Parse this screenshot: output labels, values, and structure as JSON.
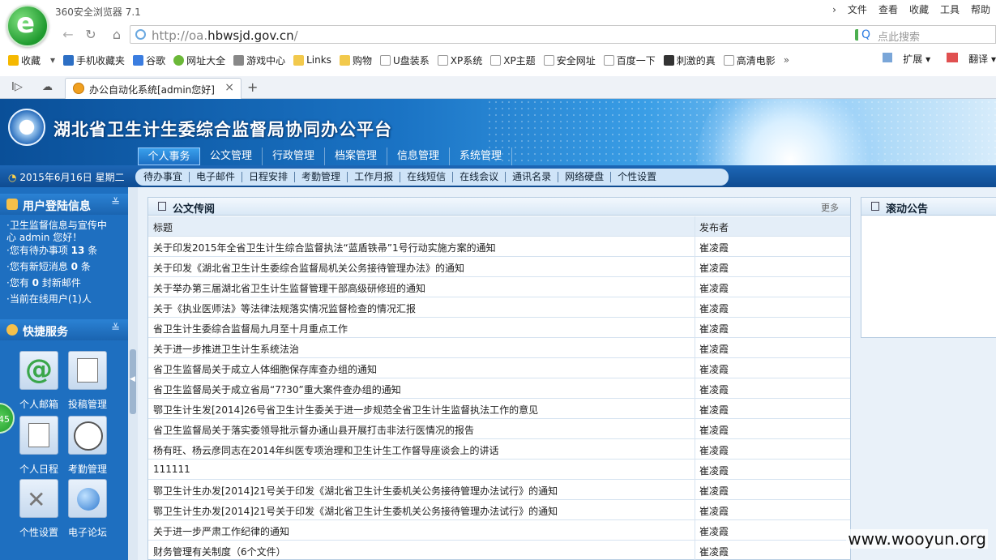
{
  "browser": {
    "app_name": "360安全浏览器 7.1",
    "menu": [
      "文件",
      "查看",
      "收藏",
      "工具",
      "帮助"
    ],
    "url_prefix": "http://oa.",
    "url_domain": "hbwsjd.gov.cn",
    "url_suffix": "/",
    "search_placeholder": "点此搜索",
    "bookmarks": [
      "收藏",
      "手机收藏夹",
      "谷歌",
      "网址大全",
      "游戏中心",
      "Links",
      "购物",
      "U盘装系",
      "XP系统",
      "XP主题",
      "安全网址",
      "百度一下",
      "刺激的真",
      "高清电影"
    ],
    "bookmarks_more": "»",
    "extensions": "扩展",
    "translate": "翻译",
    "tab_title": "办公自动化系统[admin您好]",
    "tab_close": "×",
    "new_tab": "+"
  },
  "site": {
    "title": "湖北省卫生计生委综合监督局协同办公平台",
    "main_nav": [
      "个人事务",
      "公文管理",
      "行政管理",
      "档案管理",
      "信息管理",
      "系统管理"
    ],
    "date": "2015年6月16日 星期二",
    "sub_nav": [
      "待办事宜",
      "电子邮件",
      "日程安排",
      "考勤管理",
      "工作月报",
      "在线短信",
      "在线会议",
      "通讯名录",
      "网络硬盘",
      "个性设置"
    ]
  },
  "sidebar": {
    "user_section_title": "用户登陆信息",
    "user_lines": [
      "卫生监督信息与宣传中",
      "心 admin 您好！"
    ],
    "todo_prefix": "·您有待办事项",
    "todo_count": "13",
    "todo_suffix": "条",
    "sms_prefix": "·您有新短消息",
    "sms_count": "0",
    "sms_suffix": "条",
    "mail_prefix": "·您有",
    "mail_count": "0",
    "mail_suffix": "封新邮件",
    "online_line": "·当前在线用户(1)人",
    "quick_title": "快捷服务",
    "quick_items": [
      "个人邮箱",
      "投稿管理",
      "个人日程",
      "考勤管理",
      "个性设置",
      "电子论坛"
    ],
    "badge": "45"
  },
  "documents": {
    "title": "公文传阅",
    "more": "更多",
    "col_title": "标题",
    "col_publisher": "发布者",
    "rows": [
      {
        "title": "关于印发2015年全省卫生计生综合监督执法“蓝盾铁帚”1号行动实施方案的通知",
        "publisher": "崔凌霞"
      },
      {
        "title": "关于印发《湖北省卫生计生委综合监督局机关公务接待管理办法》的通知",
        "publisher": "崔凌霞"
      },
      {
        "title": "关于举办第三届湖北省卫生计生监督管理干部高级研修班的通知",
        "publisher": "崔凌霞"
      },
      {
        "title": "关于《执业医师法》等法律法规落实情况监督检查的情况汇报",
        "publisher": "崔凌霞"
      },
      {
        "title": "省卫生计生委综合监督局九月至十月重点工作",
        "publisher": "崔凌霞"
      },
      {
        "title": "关于进一步推进卫生计生系统法治",
        "publisher": "崔凌霞"
      },
      {
        "title": "省卫生监督局关于成立人体细胞保存库查办组的通知",
        "publisher": "崔凌霞"
      },
      {
        "title": "省卫生监督局关于成立省局“7?30”重大案件查办组的通知",
        "publisher": "崔凌霞"
      },
      {
        "title": "鄂卫生计生发[2014]26号省卫生计生委关于进一步规范全省卫生计生监督执法工作的意见",
        "publisher": "崔凌霞"
      },
      {
        "title": "省卫生监督局关于落实委领导批示督办通山县开展打击非法行医情况的报告",
        "publisher": "崔凌霞"
      },
      {
        "title": "杨有旺、杨云彦同志在2014年纠医专项治理和卫生计生工作督导座谈会上的讲话",
        "publisher": "崔凌霞"
      },
      {
        "title": "111111",
        "publisher": "崔凌霞"
      },
      {
        "title": "鄂卫生计生办发[2014]21号关于印发《湖北省卫生计生委机关公务接待管理办法试行》的通知",
        "publisher": "崔凌霞"
      },
      {
        "title": "鄂卫生计生办发[2014]21号关于印发《湖北省卫生计生委机关公务接待管理办法试行》的通知",
        "publisher": "崔凌霞"
      },
      {
        "title": "关于进一步严肃工作纪律的通知",
        "publisher": "崔凌霞"
      },
      {
        "title": "财务管理有关制度（6个文件）",
        "publisher": "崔凌霞"
      }
    ]
  },
  "announcements": {
    "title": "滚动公告"
  },
  "watermark": "www.wooyun.org"
}
